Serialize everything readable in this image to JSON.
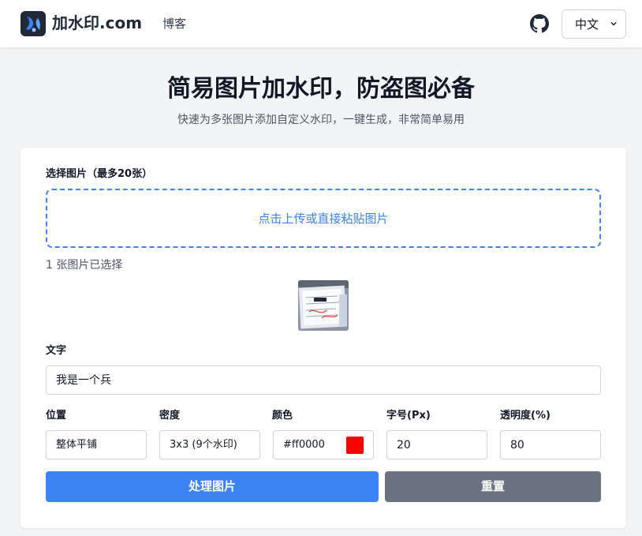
{
  "header": {
    "logo_text": "加水印.com",
    "nav_blog": "博客",
    "github_icon": "github-icon",
    "language": "中文"
  },
  "hero": {
    "title": "简易图片加水印，防盗图必备",
    "subtitle": "快速为多张图片添加自定义水印，一键生成，非常简单易用"
  },
  "form": {
    "image_label": "选择图片（最多20张）",
    "dropzone_text": "点击上传或直接粘贴图片",
    "selected_count": "1 张图片已选择",
    "text_label": "文字",
    "text_value": "我是一个兵",
    "position_label": "位置",
    "position_value": "整体平铺",
    "density_label": "密度",
    "density_value": "3x3 (9个水印)",
    "color_label": "颜色",
    "color_value": "#ff0000",
    "font_size_label": "字号(Px)",
    "font_size_value": "20",
    "opacity_label": "透明度(%)",
    "opacity_value": "80",
    "process_button": "处理图片",
    "reset_button": "重置"
  },
  "colors": {
    "primary": "#3b82f6",
    "reset": "#6b7280",
    "watermark_color": "#ff0000"
  }
}
